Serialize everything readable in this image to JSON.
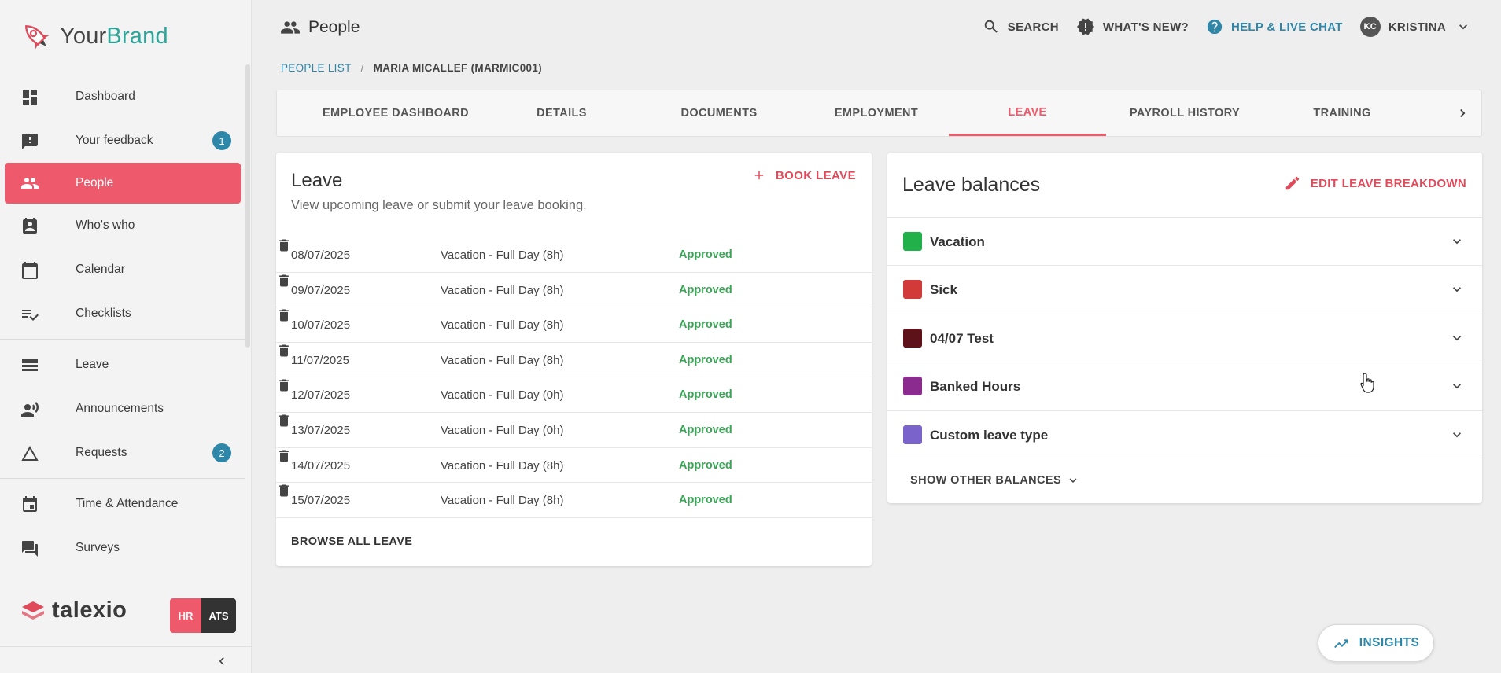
{
  "brand": {
    "name_part1": "Your",
    "name_part2": "Brand"
  },
  "sidebar": {
    "items": [
      {
        "label": "Dashboard",
        "icon": "dashboard-icon"
      },
      {
        "label": "Your feedback",
        "icon": "feedback-icon",
        "badge": "1"
      },
      {
        "label": "People",
        "icon": "people-icon",
        "active": true
      },
      {
        "label": "Who's who",
        "icon": "contact-icon"
      },
      {
        "label": "Calendar",
        "icon": "calendar-icon"
      },
      {
        "label": "Checklists",
        "icon": "checklist-icon"
      },
      {
        "label": "Leave",
        "icon": "leave-icon"
      },
      {
        "label": "Announcements",
        "icon": "announcement-icon"
      },
      {
        "label": "Requests",
        "icon": "triangle-icon",
        "badge": "2"
      },
      {
        "label": "Time & Attendance",
        "icon": "event-icon"
      },
      {
        "label": "Surveys",
        "icon": "survey-icon"
      }
    ],
    "footer_brand": "talexio",
    "app_switch": {
      "hr": "HR",
      "ats": "ATS"
    }
  },
  "header": {
    "title": "People",
    "search": "SEARCH",
    "whats_new": "WHAT'S NEW?",
    "help": "HELP & LIVE CHAT",
    "user_initials": "KC",
    "user_name": "KRISTINA"
  },
  "breadcrumb": {
    "link": "PEOPLE LIST",
    "separator": "/",
    "current": "MARIA MICALLEF (MARMIC001)"
  },
  "tabs": [
    {
      "label": "EMPLOYEE DASHBOARD"
    },
    {
      "label": "DETAILS"
    },
    {
      "label": "DOCUMENTS"
    },
    {
      "label": "EMPLOYMENT"
    },
    {
      "label": "LEAVE",
      "active": true
    },
    {
      "label": "PAYROLL HISTORY"
    },
    {
      "label": "TRAINING"
    }
  ],
  "leave": {
    "title": "Leave",
    "subtitle": "View upcoming leave or submit your leave booking.",
    "book_label": "BOOK LEAVE",
    "rows": [
      {
        "date": "08/07/2025",
        "type": "Vacation - Full Day (8h)",
        "status": "Approved"
      },
      {
        "date": "09/07/2025",
        "type": "Vacation - Full Day (8h)",
        "status": "Approved"
      },
      {
        "date": "10/07/2025",
        "type": "Vacation - Full Day (8h)",
        "status": "Approved"
      },
      {
        "date": "11/07/2025",
        "type": "Vacation - Full Day (8h)",
        "status": "Approved"
      },
      {
        "date": "12/07/2025",
        "type": "Vacation - Full Day (0h)",
        "status": "Approved"
      },
      {
        "date": "13/07/2025",
        "type": "Vacation - Full Day (0h)",
        "status": "Approved"
      },
      {
        "date": "14/07/2025",
        "type": "Vacation - Full Day (8h)",
        "status": "Approved"
      },
      {
        "date": "15/07/2025",
        "type": "Vacation - Full Day (8h)",
        "status": "Approved"
      }
    ],
    "browse_label": "BROWSE ALL LEAVE"
  },
  "balances": {
    "title": "Leave balances",
    "edit_label": "EDIT LEAVE BREAKDOWN",
    "items": [
      {
        "label": "Vacation",
        "color": "#22b04b"
      },
      {
        "label": "Sick",
        "color": "#d23a3a"
      },
      {
        "label": "04/07 Test",
        "color": "#5c1218"
      },
      {
        "label": "Banked Hours",
        "color": "#8b2a8f"
      },
      {
        "label": "Custom leave type",
        "color": "#7b63cc"
      }
    ],
    "show_other_label": "SHOW OTHER BALANCES"
  },
  "insights_label": "INSIGHTS",
  "colors": {
    "accent": "#ee5a6b",
    "link": "#2e86a8",
    "approved": "#3ba456"
  }
}
